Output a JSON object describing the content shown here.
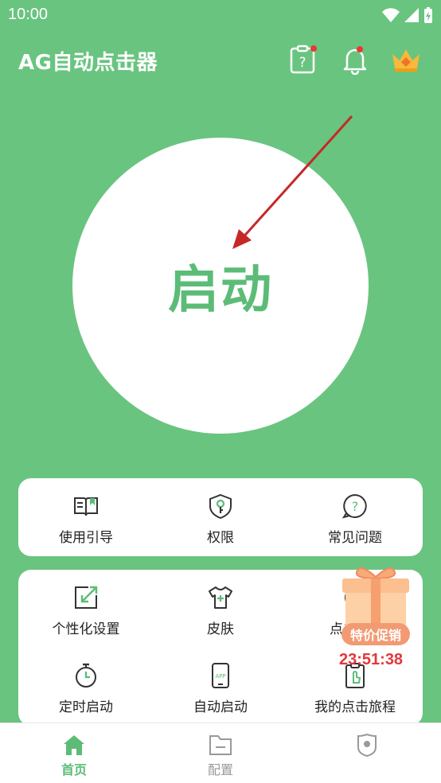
{
  "status_bar": {
    "time": "10:00"
  },
  "header": {
    "title": "AG自动点击器"
  },
  "start_button": {
    "label": "启动"
  },
  "card1": [
    {
      "label": "使用引导",
      "icon": "guide-book-icon"
    },
    {
      "label": "权限",
      "icon": "permission-shield-icon"
    },
    {
      "label": "常见问题",
      "icon": "faq-icon"
    }
  ],
  "card2": [
    {
      "label": "个性化设置",
      "icon": "personalize-icon"
    },
    {
      "label": "皮肤",
      "icon": "tshirt-icon"
    },
    {
      "label": "点击",
      "icon": "click-icon"
    },
    {
      "label": "定时启动",
      "icon": "timer-icon"
    },
    {
      "label": "自动启动",
      "icon": "app-phone-icon"
    },
    {
      "label": "我的点击旅程",
      "icon": "click-journey-icon"
    }
  ],
  "promo": {
    "badge": "特价促销",
    "timer": "23:51:38"
  },
  "nav": [
    {
      "label": "首页",
      "active": true
    },
    {
      "label": "配置",
      "active": false
    },
    {
      "label": "",
      "active": false
    }
  ],
  "colors": {
    "brand_green": "#69c47f",
    "accent_green": "#5cbc77",
    "promo_red": "#e2383b",
    "promo_orange": "#f29a72"
  }
}
